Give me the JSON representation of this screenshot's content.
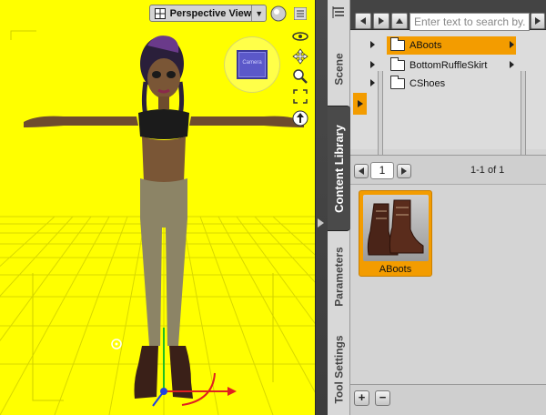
{
  "viewport": {
    "view_label": "Perspective View",
    "view_dropdown_arrow": "▼",
    "background_color": "#ffff00",
    "camera_cube_label": "Camera"
  },
  "tabs": [
    {
      "label": "Scene",
      "active": false
    },
    {
      "label": "Content Library",
      "active": true
    },
    {
      "label": "Parameters",
      "active": false
    },
    {
      "label": "Tool Settings",
      "active": false
    }
  ],
  "content_library": {
    "search_placeholder": "Enter text to search by...",
    "tree": [
      {
        "label": "ABoots",
        "selected": true
      },
      {
        "label": "BottomRuffleSkirt",
        "selected": false
      },
      {
        "label": "CShoes",
        "selected": false
      }
    ],
    "page_number": "1",
    "page_count": "1-1 of 1",
    "items": [
      {
        "label": "ABoots",
        "selected": true
      }
    ],
    "add_label": "+",
    "remove_label": "−"
  },
  "colors": {
    "selection": "#f39c00",
    "panel": "#d4d4d4",
    "dark_chrome": "#444444"
  }
}
